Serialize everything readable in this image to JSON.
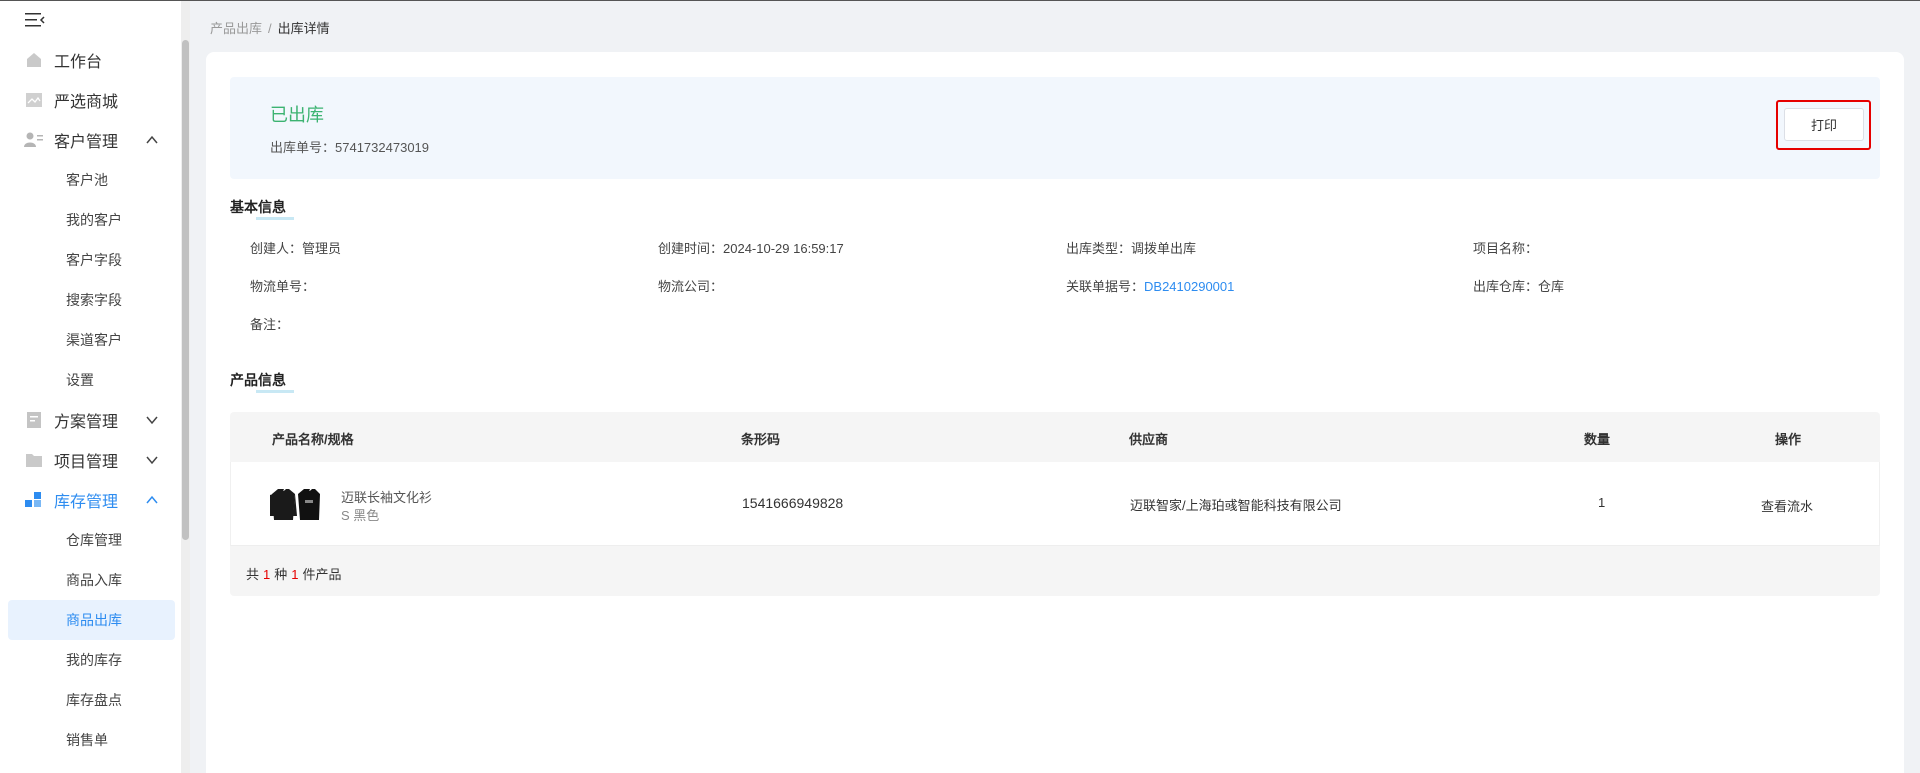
{
  "breadcrumb": {
    "parent": "产品出库",
    "separator": "/",
    "current": "出库详情"
  },
  "sidebar": {
    "items": [
      {
        "label": "工作台"
      },
      {
        "label": "严选商城"
      },
      {
        "label": "客户管理",
        "children": [
          "客户池",
          "我的客户",
          "客户字段",
          "搜索字段",
          "渠道客户",
          "设置"
        ]
      },
      {
        "label": "方案管理"
      },
      {
        "label": "项目管理"
      },
      {
        "label": "库存管理",
        "children": [
          "仓库管理",
          "商品入库",
          "商品出库",
          "我的库存",
          "库存盘点",
          "销售单"
        ]
      }
    ]
  },
  "status": {
    "title": "已出库",
    "order_label": "出库单号：",
    "order_no": "5741732473019",
    "print_label": "打印"
  },
  "basic": {
    "title": "基本信息",
    "creator_label": "创建人：",
    "creator": "管理员",
    "time_label": "创建时间：",
    "time": "2024-10-29 16:59:17",
    "type_label": "出库类型：",
    "type": "调拨单出库",
    "project_label": "项目名称：",
    "project": "",
    "logistics_no_label": "物流单号：",
    "logistics_no": "",
    "logistics_co_label": "物流公司：",
    "logistics_co": "",
    "related_label": "关联单据号：",
    "related": "DB2410290001",
    "warehouse_label": "出库仓库：",
    "warehouse": "仓库",
    "remark_label": "备注：",
    "remark": ""
  },
  "products": {
    "title": "产品信息",
    "headers": [
      "产品名称/规格",
      "条形码",
      "供应商",
      "数量",
      "操作"
    ],
    "rows": [
      {
        "name": "迈联长袖文化衫",
        "spec": "S 黑色",
        "barcode": "1541666949828",
        "supplier": "迈联智家/上海珀彧智能科技有限公司",
        "qty": "1",
        "action": "查看流水"
      }
    ],
    "footer": {
      "prefix": "共",
      "kinds": "1",
      "mid": "种",
      "count": "1",
      "suffix": "件产品"
    }
  },
  "colors": {
    "accent": "#2d8cf0",
    "success": "#3cb371",
    "highlight": "#e60000"
  }
}
